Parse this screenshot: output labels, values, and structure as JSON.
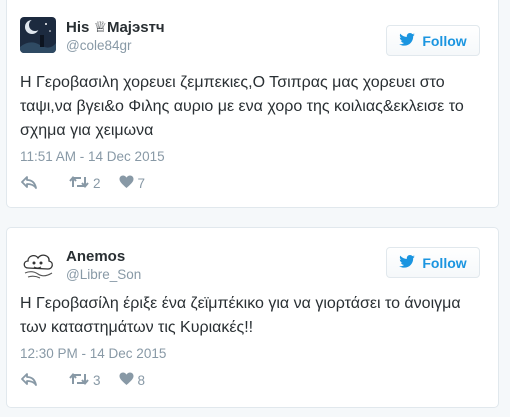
{
  "tweets": [
    {
      "name": "His ♕Majэsтч",
      "handle": "@cole84gr",
      "follow_label": "Follow",
      "text": "Η Γεροβασιλη χορευει ζεμπεκιες,Ο Τσιπρας μας χορευει στο ταψι,να βγει&ο Φιλης αυριο με ενα χορο της κοιλιας&εκλεισε το σχημα για χειμωνα",
      "timestamp": "11:51 AM - 14 Dec 2015",
      "retweets": "2",
      "likes": "7",
      "avatar_icon": "night-sky-avatar"
    },
    {
      "name": "Anemos",
      "handle": "@Libre_Son",
      "follow_label": "Follow",
      "text": "Η Γεροβασίλη έριξε ένα ζεϊμπέκικο για να γιορτάσει το άνοιγμα των καταστημάτων τις Κυριακές!!",
      "timestamp": "12:30 PM - 14 Dec 2015",
      "retweets": "3",
      "likes": "8",
      "avatar_icon": "wind-cloud-avatar"
    }
  ],
  "colors": {
    "accent": "#1b95e0",
    "muted": "#8899a6",
    "text": "#292f33",
    "border": "#e1e8ed",
    "background": "#f5f8fa"
  },
  "icons": {
    "reply": "reply-icon",
    "retweet": "retweet-icon",
    "like": "heart-icon",
    "follow": "twitter-bird-icon"
  }
}
